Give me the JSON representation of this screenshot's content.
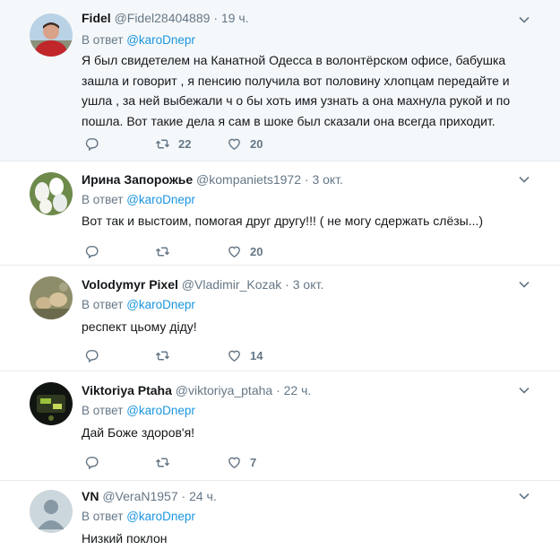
{
  "tweets": [
    {
      "name": "Fidel",
      "handle": "@Fidel28404889",
      "dot": "·",
      "time": "19 ч.",
      "reply_prefix": "В ответ",
      "reply_to": "@karoDnepr",
      "text": "Я был свидетелем на Канатной Одесса в волонтёрском офисе, бабушка зашла и говорит , я пенсию получила вот половину хлопцам передайте и ушла , за ней выбежали ч о бы хоть имя узнать а она махнула рукой и по пошла. Вот такие дела я сам в шоке был сказали она всегда приходит.",
      "retweets": "22",
      "likes": "20"
    },
    {
      "name": "Ирина Запорожье",
      "handle": "@kompaniets1972",
      "dot": "·",
      "time": "3 окт.",
      "reply_prefix": "В ответ",
      "reply_to": "@karoDnepr",
      "text": "Вот так и выстоим, помогая друг другу!!! ( не могу сдержать слёзы...)",
      "retweets": "",
      "likes": "20"
    },
    {
      "name": "Volodymyr Pixel",
      "handle": "@Vladimir_Kozak",
      "dot": "·",
      "time": "3 окт.",
      "reply_prefix": "В ответ",
      "reply_to": "@karoDnepr",
      "text": "респект цьому діду!",
      "retweets": "",
      "likes": "14"
    },
    {
      "name": "Viktoriya Ptaha",
      "handle": "@viktoriya_ptaha",
      "dot": "·",
      "time": "22 ч.",
      "reply_prefix": "В ответ",
      "reply_to": "@karoDnepr",
      "text": "Дай Боже здоров'я!",
      "retweets": "",
      "likes": "7"
    },
    {
      "name": "VN",
      "handle": "@VeraN1957",
      "dot": "·",
      "time": "24 ч.",
      "reply_prefix": "В ответ",
      "reply_to": "@karoDnepr",
      "text": "Низкий поклон",
      "retweets": "",
      "likes": ""
    }
  ],
  "colors": {
    "link": "#1b95e0",
    "muted": "#657786",
    "highlight_bg": "#f5f8fa",
    "divider": "#e6ecf0"
  },
  "icons": [
    "reply-icon",
    "retweet-icon",
    "like-icon",
    "chevron-down-icon"
  ]
}
